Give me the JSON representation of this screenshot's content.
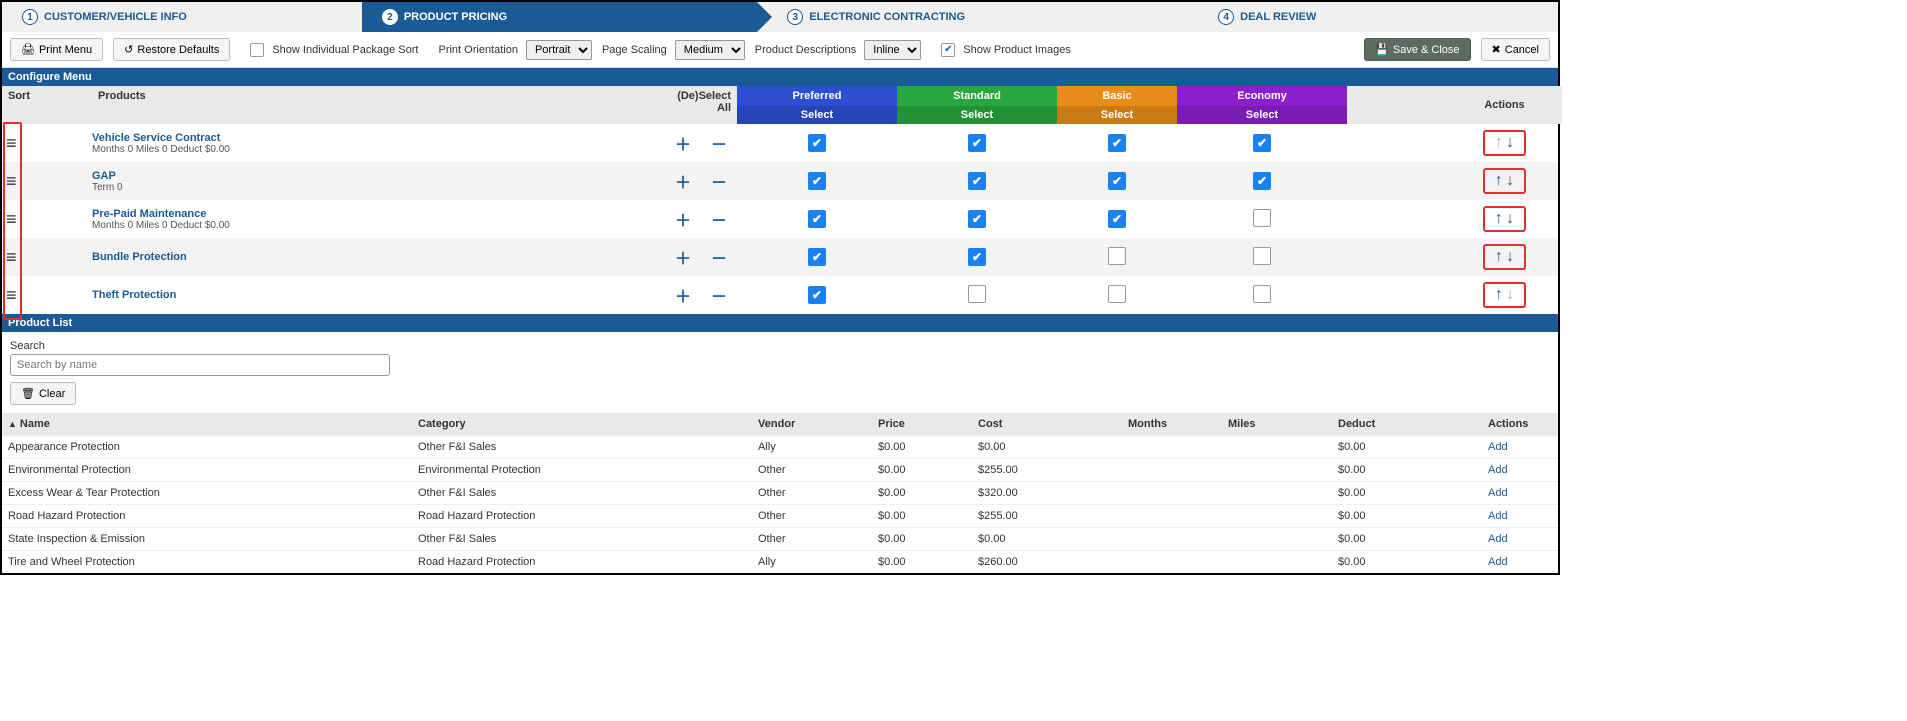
{
  "steps": [
    {
      "num": "1",
      "label": "CUSTOMER/VEHICLE INFO"
    },
    {
      "num": "2",
      "label": "PRODUCT PRICING"
    },
    {
      "num": "3",
      "label": "ELECTRONIC CONTRACTING"
    },
    {
      "num": "4",
      "label": "DEAL REVIEW"
    }
  ],
  "toolbar": {
    "print_menu": "Print Menu",
    "restore_defaults": "Restore Defaults",
    "show_individual": "Show Individual Package Sort",
    "print_orientation_label": "Print Orientation",
    "print_orientation_value": "Portrait",
    "page_scaling_label": "Page Scaling",
    "page_scaling_value": "Medium",
    "product_desc_label": "Product Descriptions",
    "product_desc_value": "Inline",
    "show_images": "Show Product Images",
    "save_close": "Save & Close",
    "cancel": "Cancel"
  },
  "configure": {
    "title": "Configure Menu",
    "headers": {
      "sort": "Sort",
      "products": "Products",
      "deselect": "(De)Select All",
      "actions": "Actions"
    },
    "tiers": [
      {
        "key": "preferred",
        "name": "Preferred",
        "select": "Select"
      },
      {
        "key": "standard",
        "name": "Standard",
        "select": "Select"
      },
      {
        "key": "basic",
        "name": "Basic",
        "select": "Select"
      },
      {
        "key": "economy",
        "name": "Economy",
        "select": "Select"
      }
    ],
    "rows": [
      {
        "name": "Vehicle Service Contract",
        "sub": "Months 0  Miles 0  Deduct $0.00",
        "checks": [
          true,
          true,
          true,
          true
        ],
        "up_disabled": true,
        "down_disabled": false
      },
      {
        "name": "GAP",
        "sub": "Term 0",
        "checks": [
          true,
          true,
          true,
          true
        ],
        "up_disabled": false,
        "down_disabled": false
      },
      {
        "name": "Pre-Paid Maintenance",
        "sub": "Months 0  Miles 0  Deduct $0.00",
        "checks": [
          true,
          true,
          true,
          false
        ],
        "up_disabled": false,
        "down_disabled": false
      },
      {
        "name": "Bundle Protection",
        "sub": "",
        "checks": [
          true,
          true,
          false,
          false
        ],
        "up_disabled": false,
        "down_disabled": false
      },
      {
        "name": "Theft Protection",
        "sub": "",
        "checks": [
          true,
          false,
          false,
          false
        ],
        "up_disabled": false,
        "down_disabled": true
      }
    ]
  },
  "product_list": {
    "title": "Product List",
    "search_label": "Search",
    "search_placeholder": "Search by name",
    "clear": "Clear",
    "columns": [
      "Name",
      "Category",
      "Vendor",
      "Price",
      "Cost",
      "Months",
      "Miles",
      "Deduct",
      "Actions"
    ],
    "rows": [
      {
        "name": "Appearance Protection",
        "category": "Other F&I Sales",
        "vendor": "Ally",
        "price": "$0.00",
        "cost": "$0.00",
        "months": "",
        "miles": "",
        "deduct": "$0.00",
        "action": "Add"
      },
      {
        "name": "Environmental Protection",
        "category": "Environmental Protection",
        "vendor": "Other",
        "price": "$0.00",
        "cost": "$255.00",
        "months": "",
        "miles": "",
        "deduct": "$0.00",
        "action": "Add"
      },
      {
        "name": "Excess Wear & Tear Protection",
        "category": "Other F&I Sales",
        "vendor": "Other",
        "price": "$0.00",
        "cost": "$320.00",
        "months": "",
        "miles": "",
        "deduct": "$0.00",
        "action": "Add"
      },
      {
        "name": "Road Hazard Protection",
        "category": "Road Hazard Protection",
        "vendor": "Other",
        "price": "$0.00",
        "cost": "$255.00",
        "months": "",
        "miles": "",
        "deduct": "$0.00",
        "action": "Add"
      },
      {
        "name": "State Inspection & Emission",
        "category": "Other F&I Sales",
        "vendor": "Other",
        "price": "$0.00",
        "cost": "$0.00",
        "months": "",
        "miles": "",
        "deduct": "$0.00",
        "action": "Add"
      },
      {
        "name": "Tire and Wheel Protection",
        "category": "Road Hazard Protection",
        "vendor": "Ally",
        "price": "$0.00",
        "cost": "$260.00",
        "months": "",
        "miles": "",
        "deduct": "$0.00",
        "action": "Add"
      }
    ]
  }
}
